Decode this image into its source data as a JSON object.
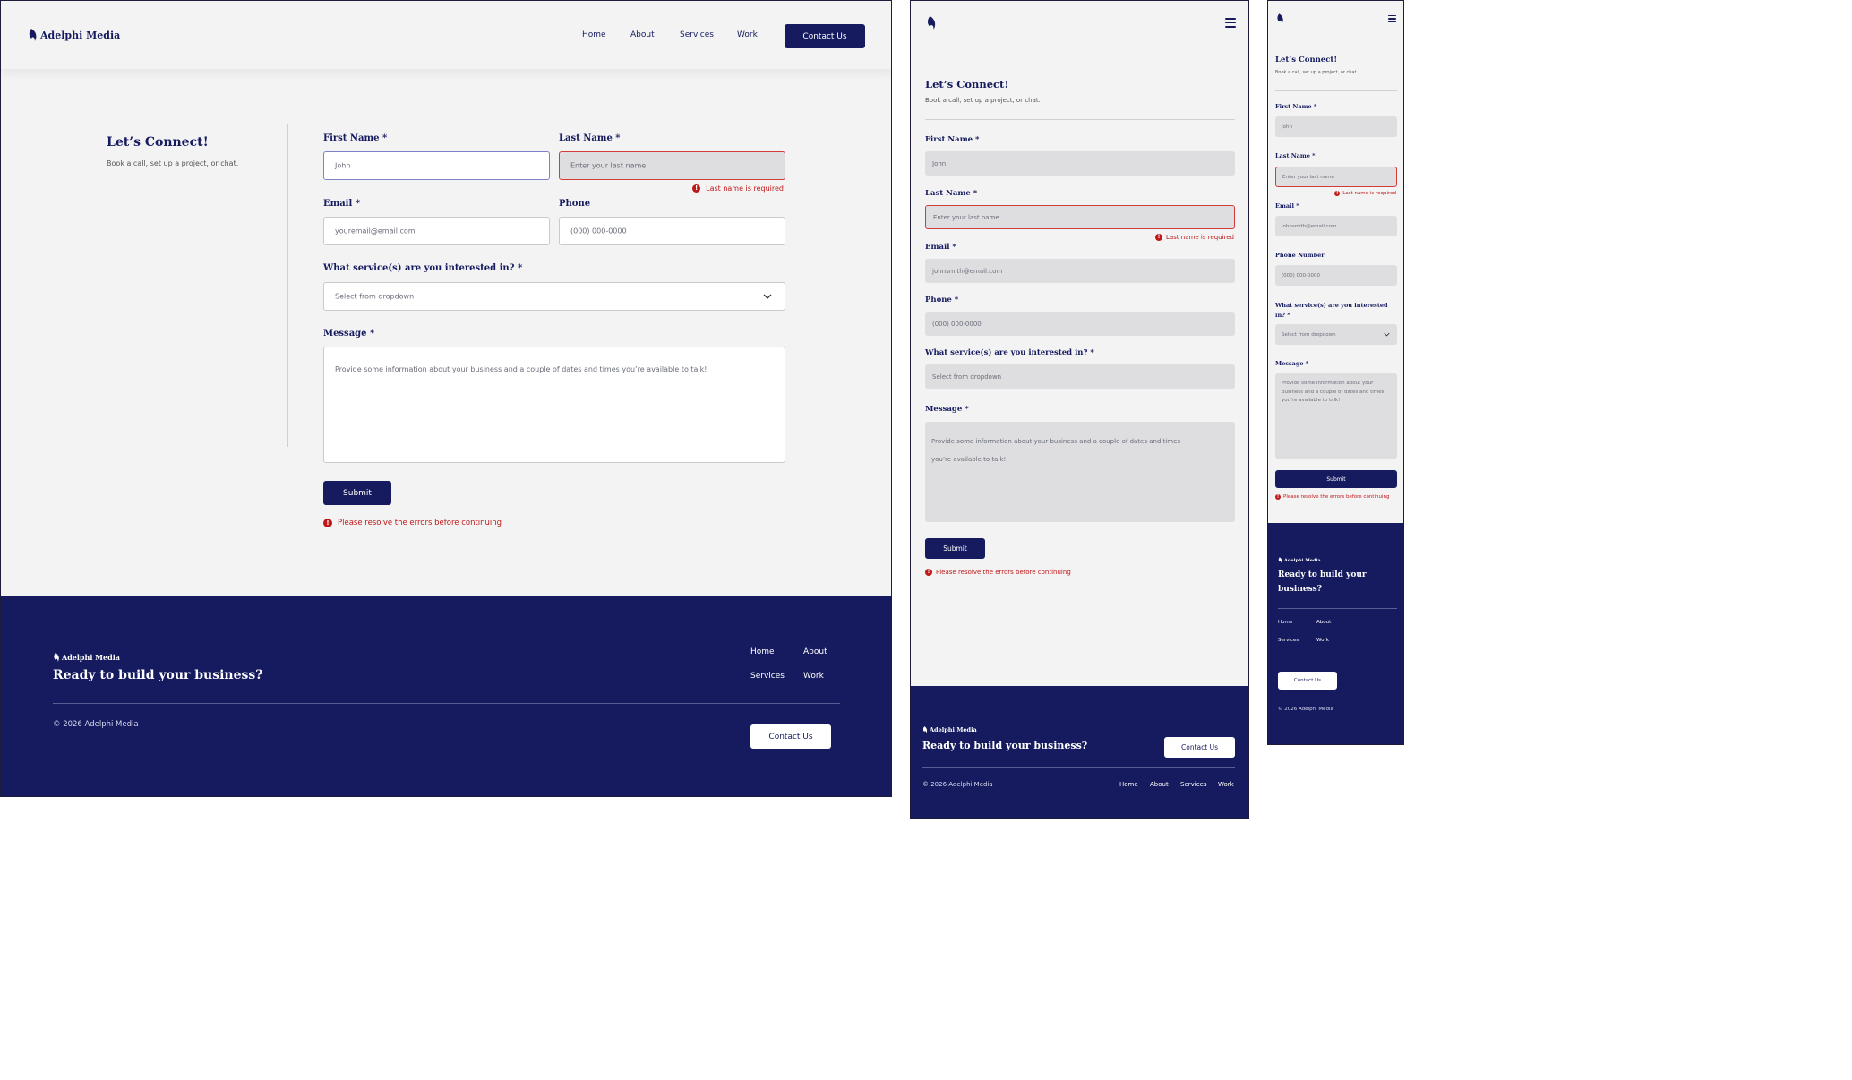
{
  "brand": {
    "name": "Adelphi Media"
  },
  "nav": {
    "home": "Home",
    "about": "About",
    "services": "Services",
    "work": "Work",
    "contact": "Contact Us"
  },
  "intro": {
    "title": "Let’s Connect!",
    "subtitle": "Book a call, set up a project, or chat."
  },
  "form": {
    "first_name_label": "First Name *",
    "first_name_value": "John",
    "last_name_label": "Last Name *",
    "last_name_placeholder": "Enter your last name",
    "last_name_error": "Last name is required",
    "email_label": "Email *",
    "email_placeholder_desktop": "youremail@email.com",
    "email_placeholder_mobile": "johnsmith@email.com",
    "phone_label": "Phone",
    "phone_label_tablet": "Phone *",
    "phone_label_mobile": "Phone Number",
    "phone_placeholder": "(000) 000-0000",
    "service_label": "What service(s) are you interested in? *",
    "service_placeholder": "Select from dropdown",
    "message_label": "Message *",
    "message_placeholder": "Provide some information about your business and a couple of dates and times you’re available to talk!",
    "submit": "Submit",
    "form_error": "Please resolve the errors before continuing"
  },
  "footer": {
    "tagline": "Ready to build your business?",
    "copyright": "© 2026 Adelphi Media",
    "links": {
      "home": "Home",
      "about": "About",
      "services": "Services",
      "work": "Work"
    },
    "contact": "Contact Us"
  },
  "colors": {
    "navy": "#151b5e",
    "error": "#c01818",
    "background": "#f3f3f4"
  }
}
